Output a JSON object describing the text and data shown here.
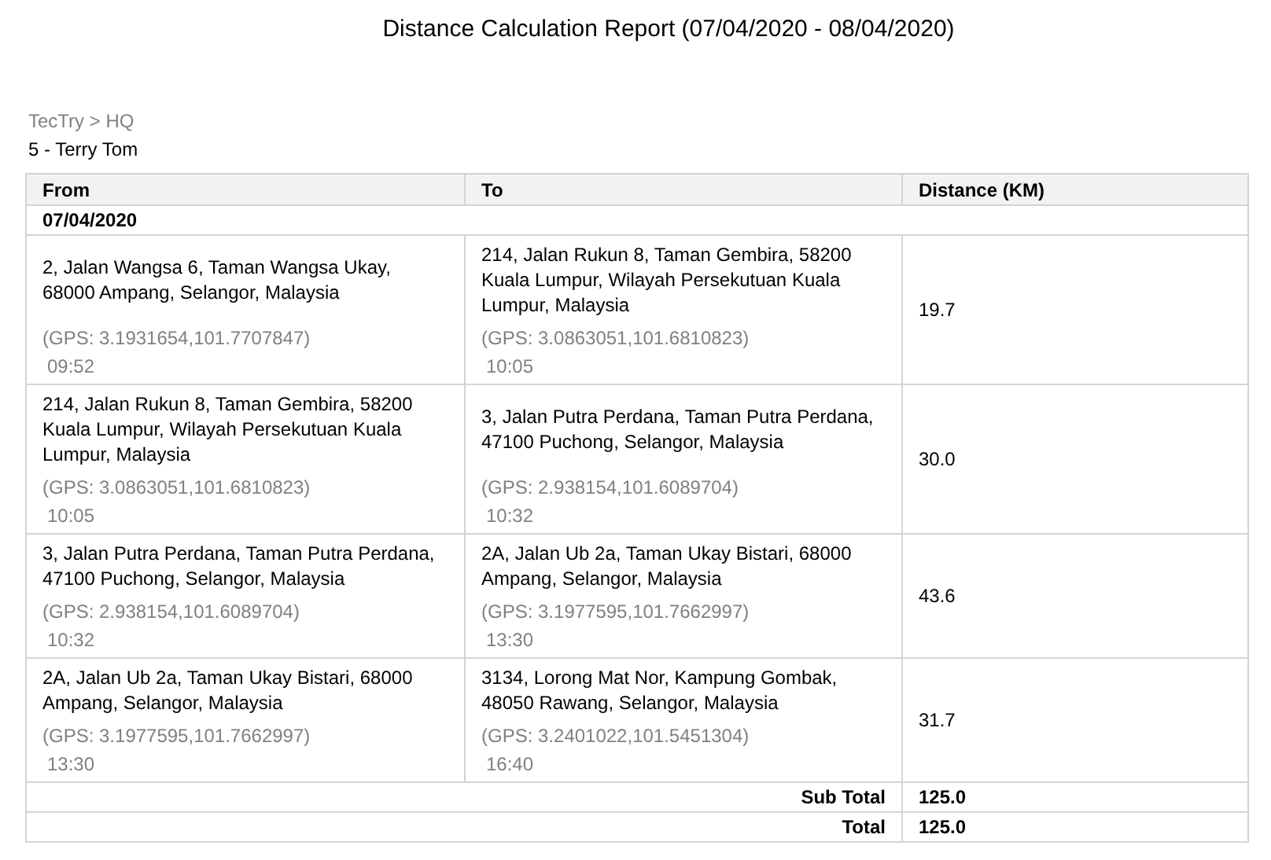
{
  "title": "Distance Calculation Report (07/04/2020 - 08/04/2020)",
  "breadcrumb": "TecTry > HQ",
  "employee": "5 - Terry Tom",
  "table": {
    "columns": [
      "From",
      "To",
      "Distance (KM)"
    ],
    "groups": [
      {
        "date": "07/04/2020",
        "rows": [
          {
            "from": {
              "address": "2, Jalan Wangsa 6, Taman Wangsa Ukay, 68000 Ampang, Selangor, Malaysia",
              "gps": "(GPS: 3.1931654,101.7707847)",
              "time": "09:52"
            },
            "to": {
              "address": "214, Jalan Rukun 8, Taman Gembira, 58200 Kuala Lumpur, Wilayah Persekutuan Kuala Lumpur, Malaysia",
              "gps": "(GPS: 3.0863051,101.6810823)",
              "time": "10:05"
            },
            "distance": "19.7"
          },
          {
            "from": {
              "address": "214, Jalan Rukun 8, Taman Gembira, 58200 Kuala Lumpur, Wilayah Persekutuan Kuala Lumpur, Malaysia",
              "gps": "(GPS: 3.0863051,101.6810823)",
              "time": "10:05"
            },
            "to": {
              "address": "3, Jalan Putra Perdana, Taman Putra Perdana, 47100 Puchong, Selangor, Malaysia",
              "gps": "(GPS: 2.938154,101.6089704)",
              "time": "10:32"
            },
            "distance": "30.0"
          },
          {
            "from": {
              "address": "3, Jalan Putra Perdana, Taman Putra Perdana, 47100 Puchong, Selangor, Malaysia",
              "gps": "(GPS: 2.938154,101.6089704)",
              "time": "10:32"
            },
            "to": {
              "address": "2A, Jalan Ub 2a, Taman Ukay Bistari, 68000 Ampang, Selangor, Malaysia",
              "gps": "(GPS: 3.1977595,101.7662997)",
              "time": "13:30"
            },
            "distance": "43.6"
          },
          {
            "from": {
              "address": "2A, Jalan Ub 2a, Taman Ukay Bistari, 68000 Ampang, Selangor, Malaysia",
              "gps": "(GPS: 3.1977595,101.7662997)",
              "time": "13:30"
            },
            "to": {
              "address": "3134, Lorong Mat Nor, Kampung Gombak, 48050 Rawang, Selangor, Malaysia",
              "gps": "(GPS: 3.2401022,101.5451304)",
              "time": "16:40"
            },
            "distance": "31.7"
          }
        ]
      }
    ],
    "totals": [
      {
        "label": "Sub Total",
        "value": "125.0"
      },
      {
        "label": "Total",
        "value": "125.0"
      }
    ]
  }
}
